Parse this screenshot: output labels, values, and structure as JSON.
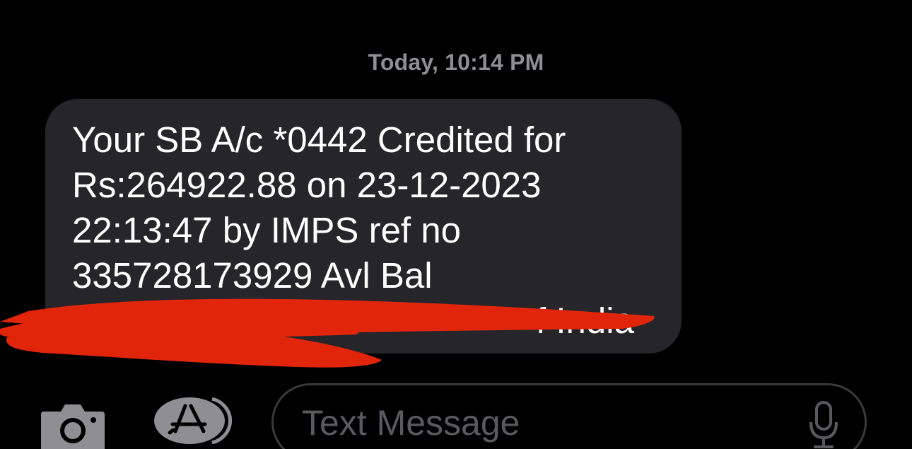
{
  "thread": {
    "timestamp": "Today, 10:14 PM"
  },
  "message": {
    "lines": [
      "Your SB A/c *0442 Credited for",
      "Rs:264922.88 on 23-12-2023",
      "22:13:47 by IMPS ref no",
      "335728173929 Avl Bal",
      "f India"
    ]
  },
  "composer": {
    "placeholder": "Text Message",
    "camera_icon": "camera-icon",
    "apps_icon": "app-store-icon",
    "mic_icon": "microphone-icon"
  },
  "colors": {
    "background": "#000000",
    "bubble": "#26262a",
    "timestamp": "#8e8e93",
    "redaction": "#e0250b",
    "placeholder": "#5a5a5e"
  }
}
